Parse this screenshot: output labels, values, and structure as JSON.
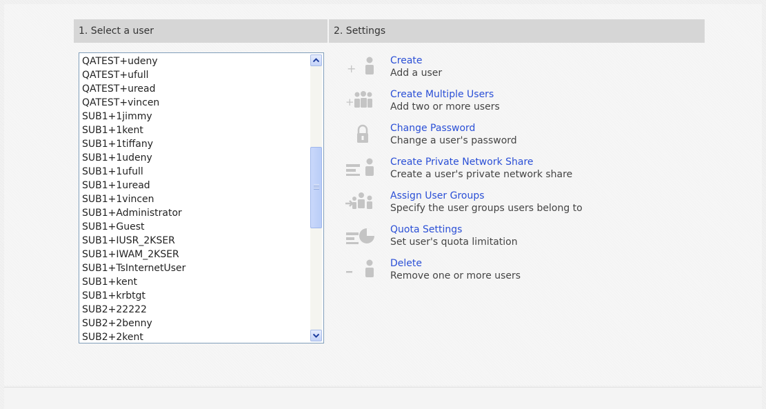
{
  "headers": {
    "users": "1. Select a user",
    "settings": "2. Settings"
  },
  "users": [
    "QATEST+udeny",
    "QATEST+ufull",
    "QATEST+uread",
    "QATEST+vincen",
    "SUB1+1jimmy",
    "SUB1+1kent",
    "SUB1+1tiffany",
    "SUB1+1udeny",
    "SUB1+1ufull",
    "SUB1+1uread",
    "SUB1+1vincen",
    "SUB1+Administrator",
    "SUB1+Guest",
    "SUB1+IUSR_2KSER",
    "SUB1+IWAM_2KSER",
    "SUB1+TsInternetUser",
    "SUB1+kent",
    "SUB1+krbtgt",
    "SUB2+22222",
    "SUB2+2benny",
    "SUB2+2kent"
  ],
  "actions": [
    {
      "title": "Create",
      "desc": "Add a user",
      "icon": "add-user-icon"
    },
    {
      "title": "Create Multiple Users",
      "desc": "Add two or more users",
      "icon": "add-multiple-users-icon"
    },
    {
      "title": "Change Password",
      "desc": "Change a user's password",
      "icon": "lock-icon"
    },
    {
      "title": "Create Private Network Share",
      "desc": "Create a user's private network share",
      "icon": "network-share-icon"
    },
    {
      "title": "Assign User Groups",
      "desc": "Specify the user groups users belong to",
      "icon": "user-groups-icon"
    },
    {
      "title": "Quota Settings",
      "desc": "Set user's quota limitation",
      "icon": "quota-pie-icon"
    },
    {
      "title": "Delete",
      "desc": "Remove one or more users",
      "icon": "remove-user-icon"
    }
  ],
  "colors": {
    "link": "#2a4fd6",
    "header_bg": "#d6d6d6",
    "icon_gray": "#c4c4c4"
  }
}
